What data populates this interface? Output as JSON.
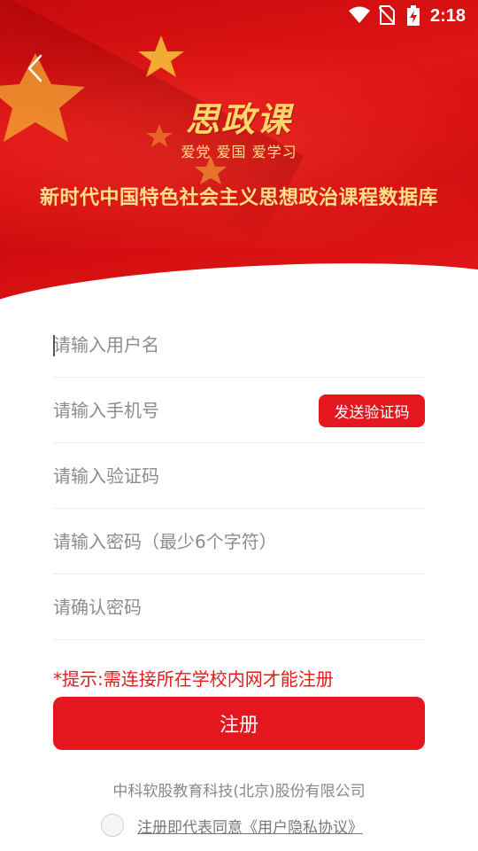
{
  "status_bar": {
    "time": "2:18",
    "icons": [
      "wifi-icon",
      "no-sim-icon",
      "battery-charging-icon"
    ]
  },
  "header": {
    "back_icon": "chevron-left-icon",
    "logo_title": "思政课",
    "slogan": "爱党  爱国  爱学习",
    "subtitle": "新时代中国特色社会主义思想政治课程数据库",
    "colors": {
      "banner_red": "#d10c0e",
      "gold_text": "#ffd66b"
    }
  },
  "form": {
    "username": {
      "value": "",
      "placeholder": "请输入用户名"
    },
    "phone": {
      "value": "",
      "placeholder": "请输入手机号"
    },
    "send_code_label": "发送验证码",
    "code": {
      "value": "",
      "placeholder": "请输入验证码"
    },
    "password": {
      "value": "",
      "placeholder": "请输入密码（最少6个字符）"
    },
    "confirm_password": {
      "value": "",
      "placeholder": "请确认密码"
    }
  },
  "hint": "*提示:需连接所在学校内网才能注册",
  "register_label": "注册",
  "footer": {
    "company": "中科软股教育科技(北京)股份有限公司",
    "agreement": "注册即代表同意《用户隐私协议》",
    "agreement_checked": false
  },
  "colors": {
    "accent": "#e3171d",
    "hint": "#e31b1b"
  }
}
